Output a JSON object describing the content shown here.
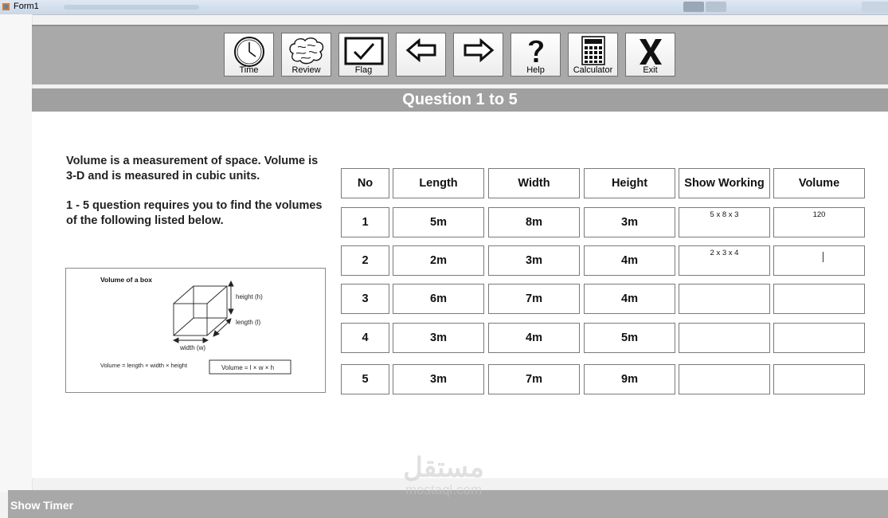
{
  "window": {
    "title": "Form1"
  },
  "toolbar": {
    "buttons": [
      {
        "label": "Time",
        "icon": "clock-icon"
      },
      {
        "label": "Review",
        "icon": "brain-icon"
      },
      {
        "label": "Flag",
        "icon": "checkmark-icon"
      },
      {
        "label": "",
        "icon": "arrow-left-icon"
      },
      {
        "label": "",
        "icon": "arrow-right-icon"
      },
      {
        "label": "Help",
        "icon": "question-icon"
      },
      {
        "label": "Calculator",
        "icon": "calculator-icon"
      },
      {
        "label": "Exit",
        "icon": "x-icon"
      }
    ]
  },
  "question_header": "Question 1 to 5",
  "intro": {
    "p1": "Volume is a measurement of space. Volume is 3-D and is measured in cubic units.",
    "p2": "1 - 5 question requires you to find the volumes of the following listed below."
  },
  "diagram": {
    "title": "Volume of a box",
    "height_label": "height (h)",
    "length_label": "length (l)",
    "width_label": "width (w)",
    "formula_text": "Volume = length × width × height",
    "formula_box": "Volume = l × w × h"
  },
  "table": {
    "headers": [
      "No",
      "Length",
      "Width",
      "Height",
      "Show Working",
      "Volume"
    ],
    "rows": [
      {
        "no": "1",
        "length": "5m",
        "width": "8m",
        "height": "3m",
        "working": "5 x 8 x 3",
        "volume": "120"
      },
      {
        "no": "2",
        "length": "2m",
        "width": "3m",
        "height": "4m",
        "working": "2 x 3 x 4",
        "volume": ""
      },
      {
        "no": "3",
        "length": "6m",
        "width": "7m",
        "height": "4m",
        "working": "",
        "volume": ""
      },
      {
        "no": "4",
        "length": "3m",
        "width": "4m",
        "height": "5m",
        "working": "",
        "volume": ""
      },
      {
        "no": "5",
        "length": "3m",
        "width": "7m",
        "height": "9m",
        "working": "",
        "volume": ""
      }
    ]
  },
  "status": {
    "show_timer": "Show Timer"
  },
  "watermark": {
    "arabic": "مستقل",
    "latin": "mostaql.com"
  }
}
